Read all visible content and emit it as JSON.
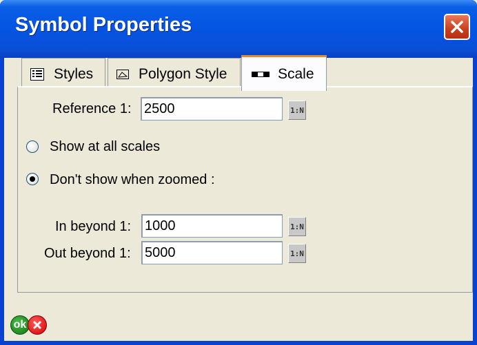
{
  "window": {
    "title": "Symbol Properties",
    "close_icon": "close-icon"
  },
  "tabs": [
    {
      "label": "Styles",
      "icon": "list-icon",
      "active": false
    },
    {
      "label": "Polygon Style",
      "icon": "polygon-icon",
      "active": false
    },
    {
      "label": "Scale",
      "icon": "scale-bar-icon",
      "active": true
    }
  ],
  "scale": {
    "reference_label": "Reference 1:",
    "reference_value": "2500",
    "scale_button_label": "1:N",
    "radio_all_label": "Show at all scales",
    "radio_zoom_label": "Don't show when zoomed :",
    "selected_option": "dont_show_when_zoomed",
    "in_label": "In beyond 1:",
    "in_value": "1000",
    "out_label": "Out beyond 1:",
    "out_value": "5000"
  },
  "footer": {
    "ok_label": "ok",
    "cancel_icon": "cancel-icon"
  }
}
